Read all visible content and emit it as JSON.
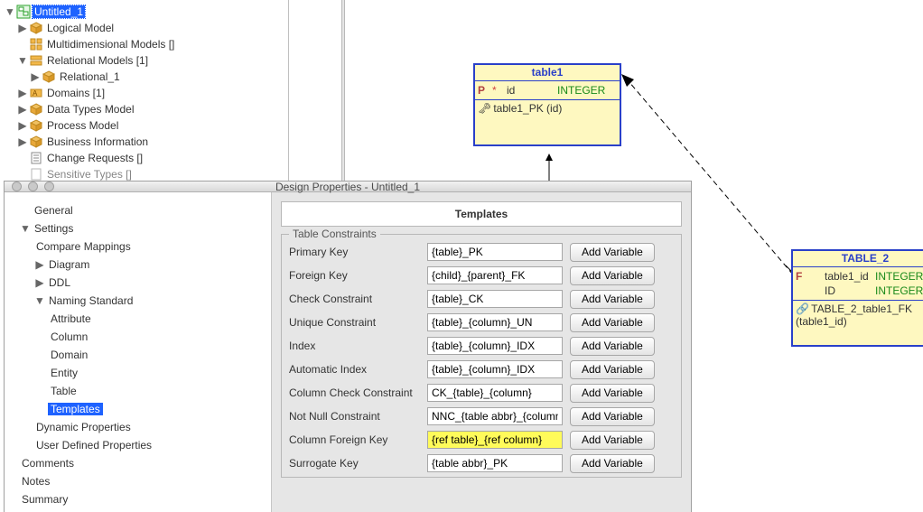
{
  "project_tree": {
    "root": "Untitled_1",
    "items": [
      "Logical Model",
      "Multidimensional Models []",
      "Relational Models [1]",
      "Relational_1",
      "Domains [1]",
      "Data Types Model",
      "Process Model",
      "Business Information",
      "Change Requests []",
      "Sensitive Types []"
    ]
  },
  "canvas": {
    "table1": {
      "name": "table1",
      "cols": [
        {
          "flag": "P",
          "star": "*",
          "name": "id",
          "type": "INTEGER"
        }
      ],
      "pk": "table1_PK (id)"
    },
    "table2": {
      "name": "TABLE_2",
      "cols": [
        {
          "flag": "F",
          "star": "",
          "name": "table1_id",
          "type": "INTEGER"
        },
        {
          "flag": "",
          "star": "",
          "name": "ID",
          "type": "INTEGER"
        }
      ],
      "fk": "TABLE_2_table1_FK (table1_id)"
    }
  },
  "dialog": {
    "title": "Design Properties - Untitled_1",
    "nav": {
      "general": "General",
      "settings": "Settings",
      "compare": "Compare Mappings",
      "diagram": "Diagram",
      "ddl": "DDL",
      "naming": "Naming Standard",
      "attribute": "Attribute",
      "column": "Column",
      "domain": "Domain",
      "entity": "Entity",
      "table": "Table",
      "templates": "Templates",
      "dynprops": "Dynamic Properties",
      "userprops": "User Defined Properties",
      "comments": "Comments",
      "notes": "Notes",
      "summary": "Summary"
    },
    "panel": {
      "heading": "Templates",
      "legend": "Table Constraints",
      "add_variable": "Add Variable",
      "rows": [
        {
          "label": "Primary Key",
          "value": "{table}_PK"
        },
        {
          "label": "Foreign Key",
          "value": "{child}_{parent}_FK"
        },
        {
          "label": "Check Constraint",
          "value": "{table}_CK"
        },
        {
          "label": "Unique Constraint",
          "value": "{table}_{column}_UN"
        },
        {
          "label": "Index",
          "value": "{table}_{column}_IDX"
        },
        {
          "label": "Automatic Index",
          "value": "{table}_{column}_IDX"
        },
        {
          "label": "Column Check Constraint",
          "value": "CK_{table}_{column}"
        },
        {
          "label": "Not Null Constraint",
          "value": "NNC_{table abbr}_{column}"
        },
        {
          "label": "Column Foreign Key",
          "value": "{ref table}_{ref column}",
          "hl": true
        },
        {
          "label": "Surrogate Key",
          "value": "{table abbr}_PK"
        }
      ]
    }
  }
}
